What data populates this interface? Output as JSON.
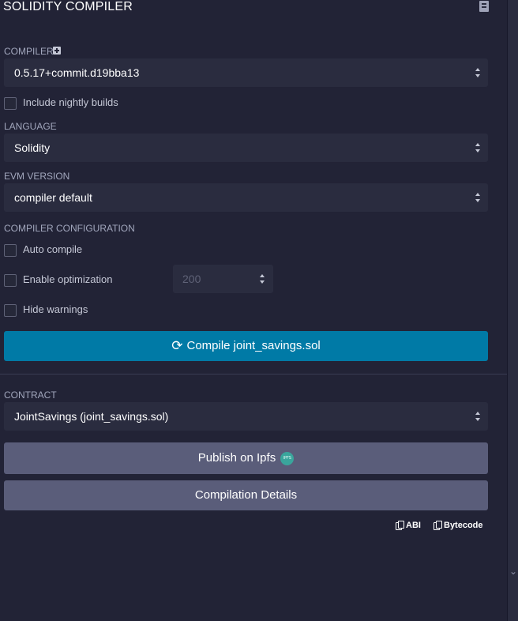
{
  "header": {
    "title": "SOLIDITY COMPILER",
    "plugin_icon": "plugin-docs-icon"
  },
  "compiler": {
    "label": "COMPILER",
    "add_icon": "plus-square-icon",
    "version": "0.5.17+commit.d19bba13",
    "nightly_label": "Include nightly builds",
    "nightly_checked": false
  },
  "language": {
    "label": "LANGUAGE",
    "value": "Solidity"
  },
  "evm": {
    "label": "EVM VERSION",
    "value": "compiler default"
  },
  "config": {
    "label": "COMPILER CONFIGURATION",
    "auto_compile_label": "Auto compile",
    "auto_compile_checked": false,
    "optimization_label": "Enable optimization",
    "optimization_checked": false,
    "runs_value": "200",
    "hide_warnings_label": "Hide warnings",
    "hide_warnings_checked": false
  },
  "compile_button": {
    "label": "Compile joint_savings.sol",
    "icon": "sync-icon"
  },
  "contract": {
    "label": "CONTRACT",
    "value": "JointSavings (joint_savings.sol)"
  },
  "publish_button": {
    "label": "Publish on Ipfs",
    "badge": "IPFS"
  },
  "details_button": {
    "label": "Compilation Details"
  },
  "copy_links": {
    "abi": "ABI",
    "bytecode": "Bytecode"
  },
  "colors": {
    "background": "#222336",
    "field": "#2a2c3f",
    "primary": "#007aa6",
    "secondary": "#5a5d7a",
    "ipfs": "#3aa59c"
  }
}
